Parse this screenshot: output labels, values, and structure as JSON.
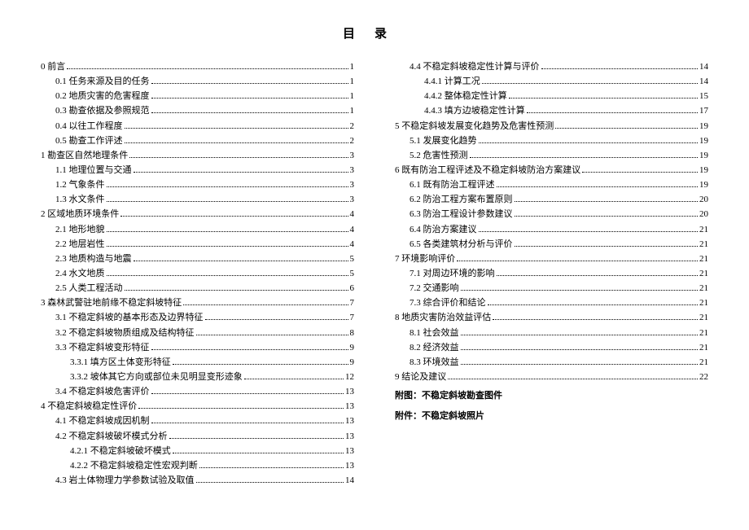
{
  "title": "目录",
  "left": [
    {
      "indent": 0,
      "label": "0 前言",
      "page": "1"
    },
    {
      "indent": 1,
      "label": "0.1 任务来源及目的任务",
      "page": "1"
    },
    {
      "indent": 1,
      "label": "0.2 地质灾害的危害程度",
      "page": "1"
    },
    {
      "indent": 1,
      "label": "0.3 勘查依据及参照规范",
      "page": "1"
    },
    {
      "indent": 1,
      "label": "0.4 以往工作程度",
      "page": "2"
    },
    {
      "indent": 1,
      "label": "0.5 勘查工作评述",
      "page": "2"
    },
    {
      "indent": 0,
      "label": "1 勘查区自然地理条件",
      "page": "3"
    },
    {
      "indent": 1,
      "label": "1.1 地理位置与交通",
      "page": "3"
    },
    {
      "indent": 1,
      "label": "1.2 气象条件",
      "page": "3"
    },
    {
      "indent": 1,
      "label": "1.3 水文条件",
      "page": "3"
    },
    {
      "indent": 0,
      "label": "2 区域地质环境条件",
      "page": "4"
    },
    {
      "indent": 1,
      "label": "2.1 地形地貌",
      "page": "4"
    },
    {
      "indent": 1,
      "label": "2.2 地层岩性",
      "page": "4"
    },
    {
      "indent": 1,
      "label": "2.3 地质构造与地震",
      "page": "5"
    },
    {
      "indent": 1,
      "label": "2.4 水文地质",
      "page": "5"
    },
    {
      "indent": 1,
      "label": "2.5 人类工程活动",
      "page": "6"
    },
    {
      "indent": 0,
      "label": "3 森林武警驻地前缘不稳定斜坡特征",
      "page": "7"
    },
    {
      "indent": 1,
      "label": "3.1 不稳定斜坡的基本形态及边界特征",
      "page": "7"
    },
    {
      "indent": 1,
      "label": "3.2 不稳定斜坡物质组成及结构特征",
      "page": "8"
    },
    {
      "indent": 1,
      "label": "3.3 不稳定斜坡变形特征",
      "page": "9"
    },
    {
      "indent": 2,
      "label": "3.3.1 填方区土体变形特征",
      "page": "9"
    },
    {
      "indent": 2,
      "label": "3.3.2 坡体其它方向或部位未见明显变形迹象",
      "page": "12"
    },
    {
      "indent": 1,
      "label": "3.4 不稳定斜坡危害评价",
      "page": "13"
    },
    {
      "indent": 0,
      "label": "4 不稳定斜坡稳定性评价",
      "page": "13"
    },
    {
      "indent": 1,
      "label": "4.1 不稳定斜坡成因机制",
      "page": "13"
    },
    {
      "indent": 1,
      "label": "4.2 不稳定斜坡破坏模式分析",
      "page": "13"
    },
    {
      "indent": 2,
      "label": "4.2.1 不稳定斜坡破坏模式",
      "page": "13"
    },
    {
      "indent": 2,
      "label": "4.2.2 不稳定斜坡稳定性宏观判断",
      "page": "13"
    },
    {
      "indent": 1,
      "label": "4.3 岩土体物理力学参数试验及取值",
      "page": "14"
    }
  ],
  "right": [
    {
      "indent": 1,
      "label": "4.4 不稳定斜坡稳定性计算与评价",
      "page": "14"
    },
    {
      "indent": 2,
      "label": "4.4.1 计算工况",
      "page": "14"
    },
    {
      "indent": 2,
      "label": "4.4.2 整体稳定性计算",
      "page": "15"
    },
    {
      "indent": 2,
      "label": "4.4.3 填方边坡稳定性计算",
      "page": "17"
    },
    {
      "indent": 0,
      "label": "5 不稳定斜坡发展变化趋势及危害性预测",
      "page": "19"
    },
    {
      "indent": 1,
      "label": "5.1 发展变化趋势",
      "page": "19"
    },
    {
      "indent": 1,
      "label": "5.2 危害性预测",
      "page": "19"
    },
    {
      "indent": 0,
      "label": "6 既有防治工程评述及不稳定斜坡防治方案建议",
      "page": "19"
    },
    {
      "indent": 1,
      "label": "6.1 既有防治工程评述",
      "page": "19"
    },
    {
      "indent": 1,
      "label": "6.2 防治工程方案布置原则",
      "page": "20"
    },
    {
      "indent": 1,
      "label": "6.3 防治工程设计参数建议",
      "page": "20"
    },
    {
      "indent": 1,
      "label": "6.4 防治方案建议",
      "page": "21"
    },
    {
      "indent": 1,
      "label": "6.5 各类建筑材分析与评价",
      "page": "21"
    },
    {
      "indent": 0,
      "label": "7 环境影响评价",
      "page": "21"
    },
    {
      "indent": 1,
      "label": "7.1 对周边环境的影响",
      "page": "21"
    },
    {
      "indent": 1,
      "label": "7.2 交通影响",
      "page": "21"
    },
    {
      "indent": 1,
      "label": "7.3 综合评价和结论",
      "page": "21"
    },
    {
      "indent": 0,
      "label": "8 地质灾害防治效益评估",
      "page": "21"
    },
    {
      "indent": 1,
      "label": "8.1 社会效益",
      "page": "21"
    },
    {
      "indent": 1,
      "label": "8.2 经济效益",
      "page": "21"
    },
    {
      "indent": 1,
      "label": "8.3 环境效益",
      "page": "21"
    },
    {
      "indent": 0,
      "label": "9 结论及建议",
      "page": "22"
    }
  ],
  "appendix": [
    "附图：不稳定斜坡勘查图件",
    "附件：不稳定斜坡照片"
  ]
}
